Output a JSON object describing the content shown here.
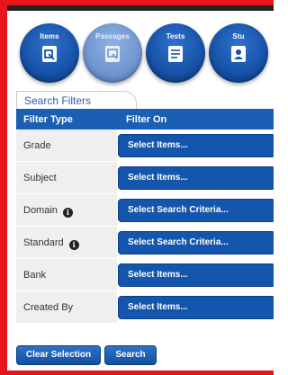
{
  "nav": {
    "items": [
      {
        "label": "Items",
        "state": "active"
      },
      {
        "label": "Passages",
        "state": "inactive"
      },
      {
        "label": "Tests",
        "state": "active"
      },
      {
        "label": "Stu",
        "state": "active"
      }
    ]
  },
  "filters": {
    "tab_title": "Search Filters",
    "col_filter_type": "Filter Type",
    "col_filter_on": "Filter On",
    "rows": [
      {
        "type": "Grade",
        "value": "Select Items...",
        "info": false
      },
      {
        "type": "Subject",
        "value": "Select Items...",
        "info": false
      },
      {
        "type": "Domain",
        "value": "Select Search Criteria...",
        "info": true
      },
      {
        "type": "Standard",
        "value": "Select Search Criteria...",
        "info": true
      },
      {
        "type": "Bank",
        "value": "Select Items...",
        "info": false
      },
      {
        "type": "Created By",
        "value": "Select Items...",
        "info": false
      }
    ],
    "info_glyph": "i"
  },
  "actions": {
    "clear_label": "Clear Selection",
    "search_label": "Search"
  },
  "colors": {
    "frame": "#e8141b",
    "primary": "#1a5fb4",
    "button": "#1456ad"
  }
}
